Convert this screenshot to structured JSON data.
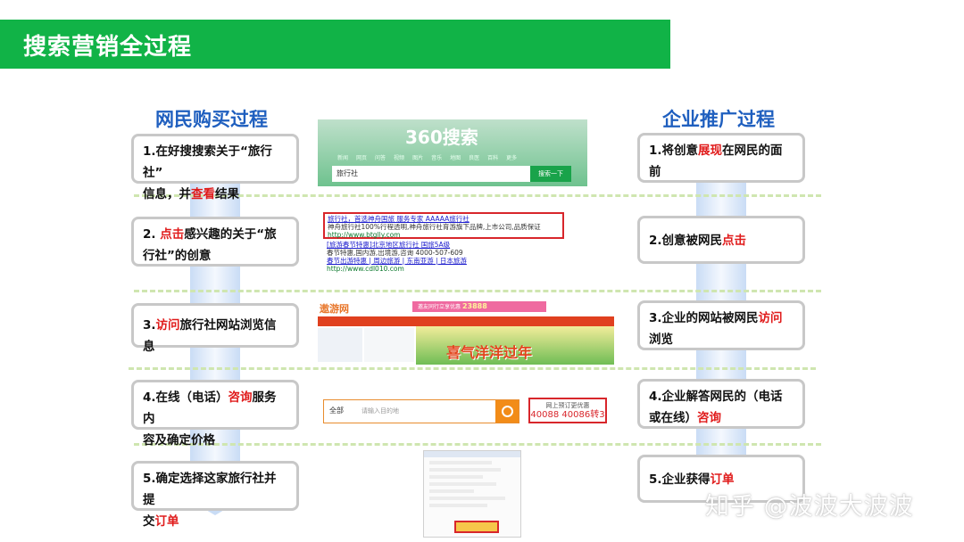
{
  "header": {
    "title": "搜索营销全过程"
  },
  "left_column": {
    "heading": "网民购买过程",
    "steps": [
      {
        "lines": [
          [
            {
              "t": "1.在好搜搜索关于“旅行社”"
            }
          ],
          [
            {
              "t": "信息，并"
            },
            {
              "t": "查看",
              "hl": true
            },
            {
              "t": "结果"
            }
          ]
        ]
      },
      {
        "lines": [
          [
            {
              "t": "2. "
            },
            {
              "t": "点击",
              "hl": true
            },
            {
              "t": "感兴趣的关于“旅"
            }
          ],
          [
            {
              "t": "行社”的创意"
            }
          ]
        ]
      },
      {
        "lines": [
          [
            {
              "t": "3."
            },
            {
              "t": "访问",
              "hl": true
            },
            {
              "t": "旅行社网站浏览信息"
            }
          ]
        ]
      },
      {
        "lines": [
          [
            {
              "t": "4.在线（电话）"
            },
            {
              "t": "咨询",
              "hl": true
            },
            {
              "t": "服务内"
            }
          ],
          [
            {
              "t": "容及确定价格"
            }
          ]
        ]
      },
      {
        "lines": [
          [
            {
              "t": "5.确定选择这家旅行社并提"
            }
          ],
          [
            {
              "t": "交"
            },
            {
              "t": "订单",
              "hl": true
            }
          ]
        ]
      }
    ]
  },
  "right_column": {
    "heading": "企业推广过程",
    "steps": [
      {
        "lines": [
          [
            {
              "t": "1.将创意"
            },
            {
              "t": "展现",
              "hl": true
            },
            {
              "t": "在网民的面"
            }
          ],
          [
            {
              "t": "前"
            }
          ]
        ]
      },
      {
        "lines": [
          [
            {
              "t": "2.创意被网民"
            },
            {
              "t": "点击",
              "hl": true
            }
          ]
        ]
      },
      {
        "lines": [
          [
            {
              "t": "3.企业的网站被网民"
            },
            {
              "t": "访问",
              "hl": true
            }
          ],
          [
            {
              "t": "浏览"
            }
          ]
        ]
      },
      {
        "lines": [
          [
            {
              "t": "4.企业解答网民的（电话"
            }
          ],
          [
            {
              "t": "或在线）"
            },
            {
              "t": "咨询",
              "hl": true
            }
          ]
        ]
      },
      {
        "lines": [
          [
            {
              "t": "5.企业获得"
            },
            {
              "t": "订单",
              "hl": true
            }
          ]
        ]
      }
    ]
  },
  "screens": {
    "search": {
      "logo": "360搜索",
      "nav": [
        "新闻",
        "网页",
        "问答",
        "视频",
        "图片",
        "音乐",
        "地图",
        "良医",
        "百科",
        "更多"
      ],
      "query": "旅行社",
      "button": "搜索一下"
    },
    "results": {
      "ad_title": "旅行社，首选神舟国旅 服务专家 AAAAA旅行社",
      "ad_desc": "神舟旅行社100%行程透明,神舟旅行社育游旗下品牌,上市公司,品质保证",
      "ad_url": "http://www.btglly.com",
      "r2_title": "[旅游春节特惠]北京地区旅行社 国旅5A级",
      "r2_desc": "春节特惠,国内游,出境游,咨询 4000-507-609",
      "r2_links": "春节出游特惠 | 周边旅游 | 东南亚游 | 日本旅游",
      "r2_url": "http://www.cdl010.com"
    },
    "site": {
      "logo": "遨游网",
      "promo_text": "邀友同行立享优惠",
      "promo_price": "23888",
      "banner": "喜气洋洋过年"
    },
    "consult": {
      "scope": "全部",
      "placeholder": "请输入目的地",
      "hotline_label": "网上预订更优惠",
      "hotline_number": "40088 40086转3"
    }
  },
  "watermark": "知乎 @波波大波波"
}
